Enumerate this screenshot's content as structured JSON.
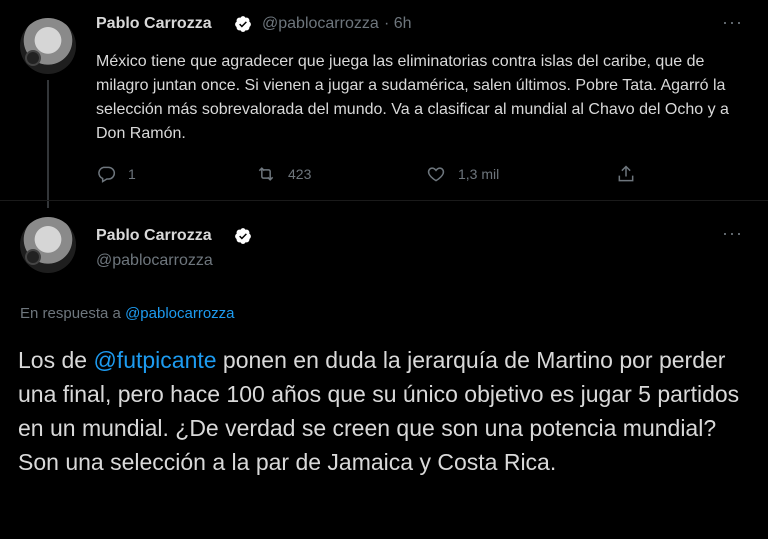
{
  "tweet1": {
    "author_name": "Pablo Carrozza",
    "handle": "@pablocarrozza",
    "time": "· 6h",
    "text": "México tiene que agradecer que juega las eliminatorias contra islas del caribe, que de milagro juntan once. Si vienen a jugar a sudamérica, salen últimos. Pobre Tata. Agarró la selección más sobrevalorada del mundo. Va a clasificar al mundial al Chavo del Ocho y a Don Ramón.",
    "replies": "1",
    "retweets": "423",
    "likes": "1,3 mil",
    "more": "···"
  },
  "tweet2": {
    "author_name": "Pablo Carrozza",
    "handle": "@pablocarrozza",
    "more": "···",
    "reply_prefix": "En respuesta a ",
    "reply_handle": "@pablocarrozza",
    "text_before": "Los de ",
    "mention": "@futpicante",
    "text_after": " ponen en duda la jerarquía de Martino por perder una final, pero hace 100 años que su único objetivo es jugar 5 partidos en un mundial. ¿De verdad se creen que son una potencia mundial? Son una selección a la par de Jamaica y Costa Rica."
  },
  "colors": {
    "background": "#000000",
    "text": "#d9d9d9",
    "secondary": "#6e767d",
    "link": "#1d9bf0"
  },
  "icons": [
    "verified-badge-icon",
    "reply-icon",
    "retweet-icon",
    "like-icon",
    "share-icon",
    "more-icon"
  ]
}
